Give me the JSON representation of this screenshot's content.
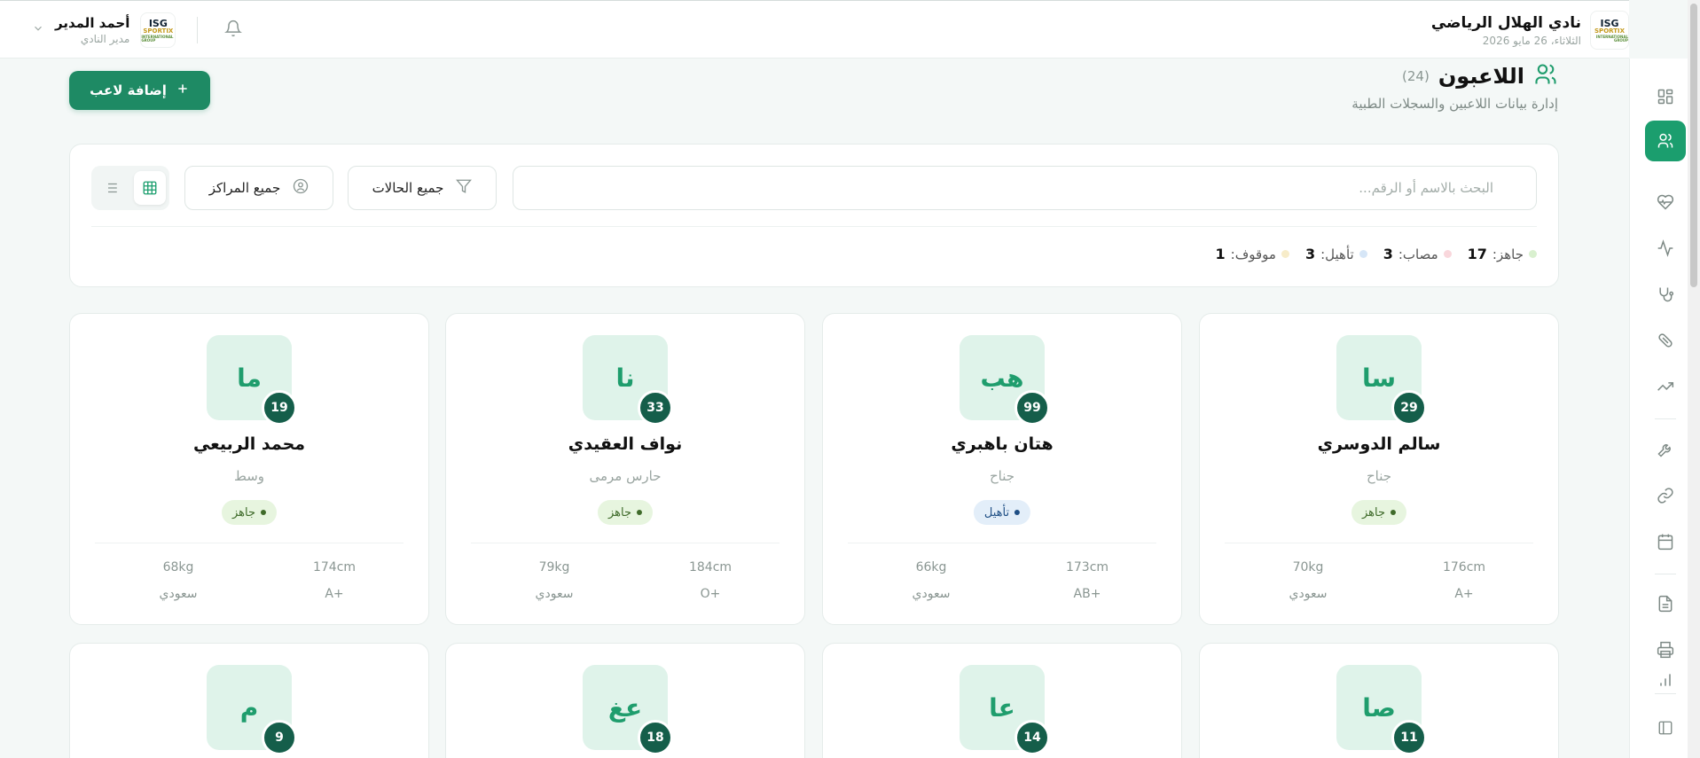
{
  "header": {
    "club_name": "نادي الهلال الرياضي",
    "date": "الثلاثاء، 26 مايو 2026",
    "user_name": "أحمد المدير",
    "user_role": "مدير النادي",
    "logo": {
      "line1": "ISG",
      "line2": "SPORTIX",
      "line3": "INTERNATIONAL GROUP"
    }
  },
  "page": {
    "title": "اللاعبون",
    "count": "(24)",
    "subtitle": "إدارة بيانات اللاعبين والسجلات الطبية",
    "add_button": "إضافة لاعب"
  },
  "filters": {
    "search_placeholder": "البحث بالاسم أو الرقم...",
    "status_select": "جميع الحالات",
    "position_select": "جميع المراكز"
  },
  "stats": [
    {
      "label": "جاهز:",
      "value": "17",
      "color": "#d9f0cf"
    },
    {
      "label": "مصاب:",
      "value": "3",
      "color": "#f9d7dc"
    },
    {
      "label": "تأهيل:",
      "value": "3",
      "color": "#d6e6f7"
    },
    {
      "label": "موقوف:",
      "value": "1",
      "color": "#f7ecc9"
    }
  ],
  "players": [
    {
      "initials": "سا",
      "number": "29",
      "name": "سالم الدوسري",
      "position": "جناح",
      "status": "جاهز",
      "status_type": "ready",
      "height": "176cm",
      "weight": "70kg",
      "blood": "A+",
      "nationality": "سعودي"
    },
    {
      "initials": "هب",
      "number": "99",
      "name": "هتان باهبري",
      "position": "جناح",
      "status": "تأهيل",
      "status_type": "rehab",
      "height": "173cm",
      "weight": "66kg",
      "blood": "AB+",
      "nationality": "سعودي"
    },
    {
      "initials": "نا",
      "number": "33",
      "name": "نواف العقيدي",
      "position": "حارس مرمى",
      "status": "جاهز",
      "status_type": "ready",
      "height": "184cm",
      "weight": "79kg",
      "blood": "O+",
      "nationality": "سعودي"
    },
    {
      "initials": "ما",
      "number": "19",
      "name": "محمد الربيعي",
      "position": "وسط",
      "status": "جاهز",
      "status_type": "ready",
      "height": "174cm",
      "weight": "68kg",
      "blood": "A+",
      "nationality": "سعودي"
    },
    {
      "initials": "صا",
      "number": "11"
    },
    {
      "initials": "عا",
      "number": "14"
    },
    {
      "initials": "عغ",
      "number": "18"
    },
    {
      "initials": "م",
      "number": "9"
    }
  ],
  "sidebar_icons": [
    "dashboard-icon",
    "players-icon",
    "heart-pulse-icon",
    "activity-icon",
    "stethoscope-icon",
    "pill-icon",
    "trending-up-icon",
    "wrench-icon",
    "link-icon",
    "calendar-icon",
    "document-icon",
    "printer-icon",
    "chart-icon",
    "collapse-sidebar-icon"
  ]
}
